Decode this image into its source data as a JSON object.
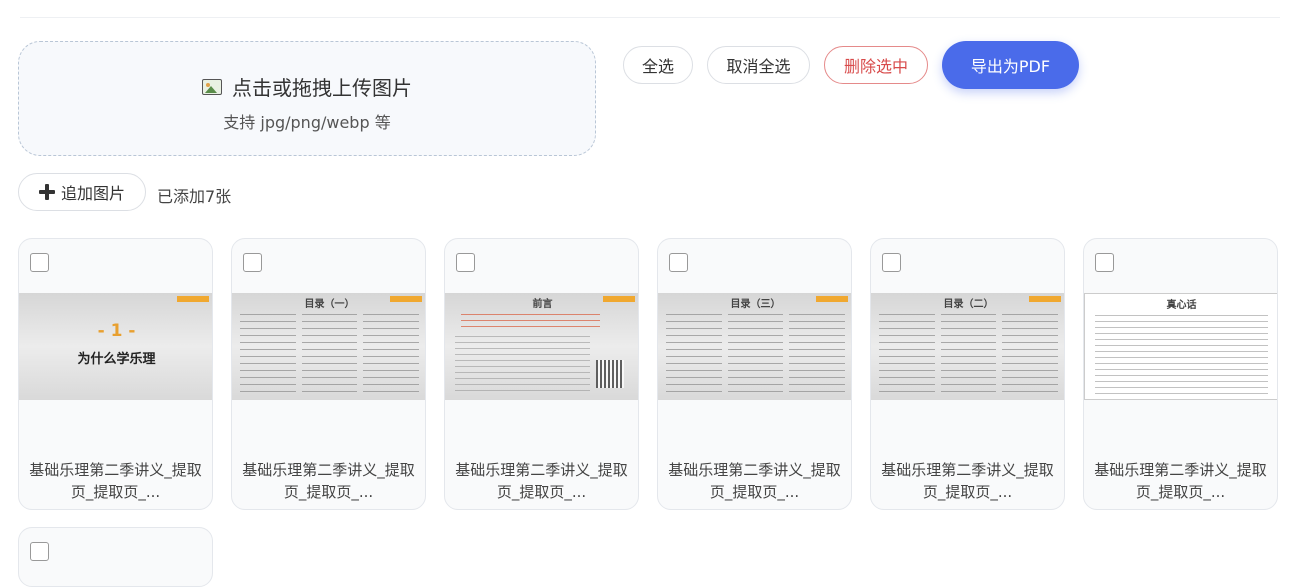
{
  "upload": {
    "title": "点击或拖拽上传图片",
    "subtitle": "支持 jpg/png/webp 等"
  },
  "toolbar": {
    "select_all": "全选",
    "deselect_all": "取消全选",
    "delete_selected": "删除选中",
    "export_pdf": "导出为PDF"
  },
  "add": {
    "label": "追加图片",
    "count_text": "已添加7张"
  },
  "colors": {
    "accent": "#4a6bea",
    "danger": "#d84b4b"
  },
  "cards": [
    {
      "caption": "基础乐理第二季讲义_提取页_提取页_...",
      "thumb_num": "- 1 -",
      "thumb_title": "为什么学乐理",
      "checked": false
    },
    {
      "caption": "基础乐理第二季讲义_提取页_提取页_...",
      "thumb_title": "目录（一）",
      "checked": false
    },
    {
      "caption": "基础乐理第二季讲义_提取页_提取页_...",
      "thumb_title": "前言",
      "checked": false
    },
    {
      "caption": "基础乐理第二季讲义_提取页_提取页_...",
      "thumb_title": "目录（三）",
      "checked": false
    },
    {
      "caption": "基础乐理第二季讲义_提取页_提取页_...",
      "thumb_title": "目录（二）",
      "checked": false
    },
    {
      "caption": "基础乐理第二季讲义_提取页_提取页_...",
      "thumb_title": "真心话",
      "checked": false
    },
    {
      "caption": "",
      "checked": false
    }
  ]
}
